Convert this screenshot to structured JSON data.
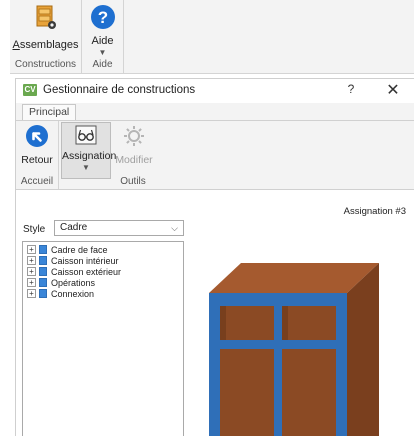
{
  "outer_ribbon": {
    "groups": [
      {
        "label": "Constructions",
        "button": {
          "label_prefix": "",
          "label_underline": "A",
          "label_rest": "ssemblages",
          "icon": "assemblies-icon"
        }
      },
      {
        "label": "Aide",
        "button": {
          "label": "Aide",
          "icon": "help-circle-icon"
        }
      }
    ]
  },
  "dialog": {
    "app_badge": "CV",
    "title": "Gestionnaire de constructions",
    "help": "?",
    "close": "✕",
    "tab": "Principal",
    "groups": [
      {
        "label": "Accueil",
        "buttons": [
          {
            "label": "Retour",
            "icon": "back-arrow-icon"
          }
        ]
      },
      {
        "label": "Outils",
        "buttons": [
          {
            "label": "Assignation",
            "icon": "glasses-icon",
            "state": "pressed"
          },
          {
            "label": "Modifier",
            "icon": "gear-icon",
            "state": "disabled"
          }
        ]
      }
    ],
    "assignation_label": "Assignation #3",
    "style": {
      "label": "Style",
      "value": "Cadre"
    },
    "tree": [
      "Cadre de face",
      "Caisson intérieur",
      "Caisson extérieur",
      "Opérations",
      "Connexion"
    ]
  },
  "colors": {
    "cabinet_wood": "#8b4a24",
    "cabinet_top": "#a55a2f",
    "cabinet_frame": "#2f6fb8",
    "app_badge": "#6aa84f"
  }
}
